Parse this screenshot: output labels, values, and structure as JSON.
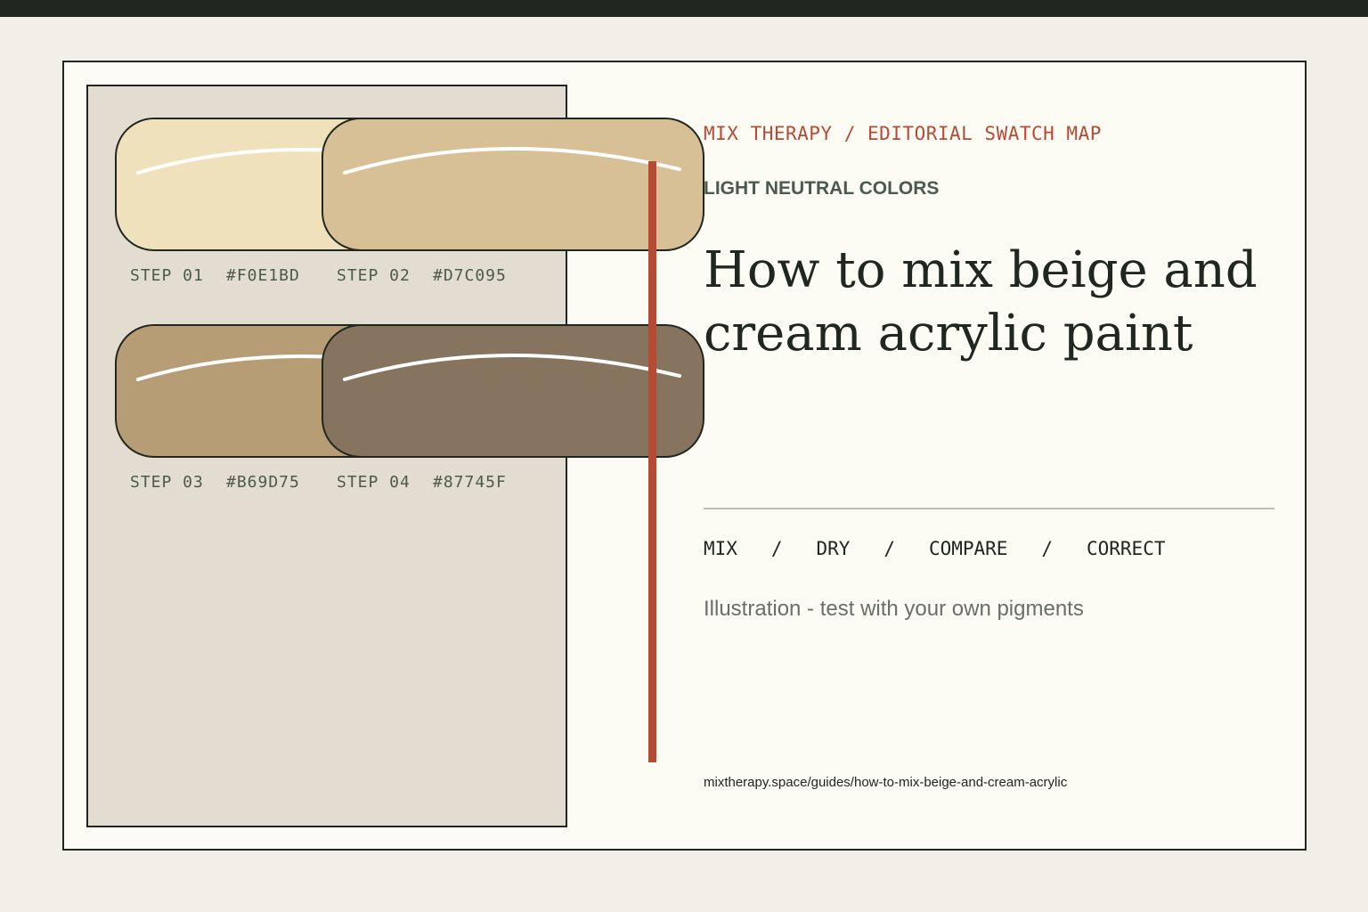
{
  "header": {
    "eyebrow": "MIX THERAPY / EDITORIAL SWATCH MAP",
    "category": "LIGHT NEUTRAL COLORS",
    "title": "How to mix beige and cream acrylic paint"
  },
  "swatches": [
    {
      "step": "STEP 01",
      "hex": "#F0E1BD",
      "color": "#F0E1BD"
    },
    {
      "step": "STEP 02",
      "hex": "#D7C095",
      "color": "#D7C095"
    },
    {
      "step": "STEP 03",
      "hex": "#B69D75",
      "color": "#B69D75"
    },
    {
      "step": "STEP 04",
      "hex": "#87745F",
      "color": "#87745F"
    }
  ],
  "process": {
    "items": [
      "MIX",
      "DRY",
      "COMPARE",
      "CORRECT"
    ],
    "separator": "/"
  },
  "note": "Illustration - test with your own pigments",
  "url": "mixtherapy.space/guides/how-to-mix-beige-and-cream-acrylic",
  "colors": {
    "accent": "#B64A35",
    "ink": "#202620",
    "panel": "#E3DDD1",
    "card": "#FCFBF4"
  }
}
